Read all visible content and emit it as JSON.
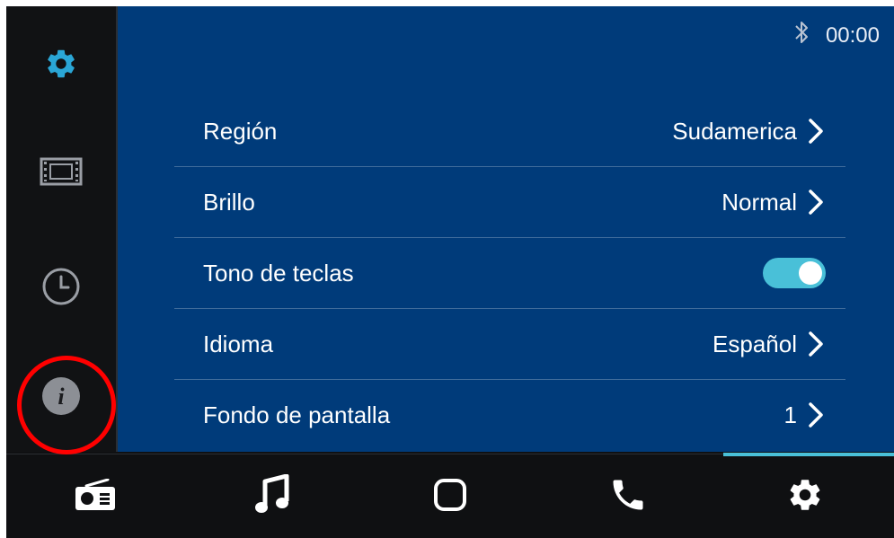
{
  "status": {
    "bluetooth_icon": "bluetooth-icon",
    "time": "00:00"
  },
  "sidebar": {
    "items": [
      {
        "name": "settings",
        "icon": "gear-icon",
        "active": true,
        "color": "#2aa6d6"
      },
      {
        "name": "video",
        "icon": "film-icon"
      },
      {
        "name": "clock",
        "icon": "clock-icon"
      },
      {
        "name": "info",
        "icon": "info-icon"
      }
    ]
  },
  "settings_list": [
    {
      "label": "Región",
      "value": "Sudamerica",
      "type": "link"
    },
    {
      "label": "Brillo",
      "value": "Normal",
      "type": "link"
    },
    {
      "label": "Tono de teclas",
      "value": "",
      "type": "toggle",
      "on": true
    },
    {
      "label": "Idioma",
      "value": "Español",
      "type": "link"
    },
    {
      "label": "Fondo de pantalla",
      "value": "1",
      "type": "link"
    }
  ],
  "bottom_nav": {
    "items": [
      {
        "name": "radio",
        "icon": "radio-icon"
      },
      {
        "name": "music",
        "icon": "music-note-icon"
      },
      {
        "name": "home",
        "icon": "home-square-icon"
      },
      {
        "name": "phone",
        "icon": "phone-icon"
      },
      {
        "name": "settings",
        "icon": "gear-icon",
        "active": true
      }
    ]
  },
  "colors": {
    "main_bg": "#003b7a",
    "accent": "#49c0d8",
    "sidebar_bg": "#111214",
    "highlight_circle": "#ff0000"
  }
}
